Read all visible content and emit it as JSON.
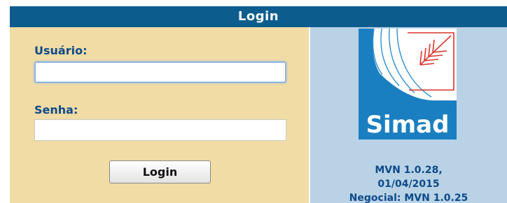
{
  "header": {
    "title": "Login"
  },
  "form": {
    "username_label": "Usuário:",
    "username_value": "",
    "password_label": "Senha:",
    "password_value": "",
    "login_button_label": "Login"
  },
  "brand": {
    "logo_text": "Simad",
    "logo_icon": "simad-book-icon",
    "version_line1": "MVN 1.0.28,",
    "version_line2": "01/04/2015",
    "version_line3": "Negocial: MVN 1.0.25"
  },
  "colors": {
    "header_bg": "#0d5c8e",
    "form_bg": "#f0dca4",
    "brand_bg": "#b9d2e6",
    "label_text": "#0d4a8a",
    "logo_blue": "#1a7fc1",
    "logo_red": "#d9332b"
  }
}
